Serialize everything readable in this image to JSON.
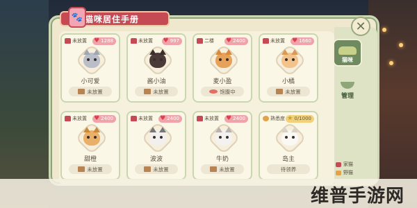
{
  "header": {
    "title": "猫咪居住手册",
    "title_icon": "paw-icon"
  },
  "close_label": "✕",
  "cards": [
    {
      "floor": "未放置",
      "value": "1288",
      "value_type": "heart",
      "name": "小可爱",
      "status": "未放置",
      "status_icon": "box",
      "cat_color": "#b9bec8",
      "ear": "#a0a6b2"
    },
    {
      "floor": "未放置",
      "value": "997",
      "value_type": "heart",
      "name": "酱小油",
      "status": "未放置",
      "status_icon": "box",
      "cat_color": "#4a3b38",
      "ear": "#3a2d2a"
    },
    {
      "floor": "二楼",
      "value": "2400",
      "value_type": "heart",
      "name": "麦小盈",
      "status": "饱腹中",
      "status_icon": "fish",
      "cat_color": "#e7a25a",
      "ear": "#d58a3e"
    },
    {
      "floor": "未放置",
      "value": "1660",
      "value_type": "heart",
      "name": "小橘",
      "status": "未放置",
      "status_icon": "box",
      "cat_color": "#f2c48b",
      "ear": "#d89a55"
    },
    {
      "floor": "未放置",
      "value": "2400",
      "value_type": "heart",
      "name": "甜橙",
      "status": "未放置",
      "status_icon": "box",
      "cat_color": "#e9b06a",
      "ear": "#c98a3c"
    },
    {
      "floor": "未放置",
      "value": "2400",
      "value_type": "heart",
      "name": "波波",
      "status": "未放置",
      "status_icon": "box",
      "cat_color": "#f2f0ee",
      "ear": "#777"
    },
    {
      "floor": "未放置",
      "value": "2400",
      "value_type": "heart",
      "name": "牛奶",
      "status": "未放置",
      "status_icon": "box",
      "cat_color": "#f4f2f0",
      "ear": "#b9b4b0"
    },
    {
      "floor": "熟悉度",
      "value": "0/1000",
      "value_type": "star",
      "name": "岛主",
      "status": "待领养",
      "status_icon": "none",
      "cat_color": "#faf8f4",
      "ear": "#d8d2c8"
    }
  ],
  "side_nav": {
    "cat_tab_label": "猫咪",
    "manage_label": "管理"
  },
  "legend": {
    "items": [
      {
        "label": "家猫",
        "color": "#c64a53"
      },
      {
        "label": "野猫",
        "color": "#e1a24a"
      }
    ]
  },
  "watermark": "维普手游网",
  "colors": {
    "accent_red": "#c64a53",
    "panel_bg": "#efe8cf",
    "card_border": "#c9d6b0",
    "heart_pill": "#f1a3aa",
    "star_pill": "#f1d27a"
  }
}
